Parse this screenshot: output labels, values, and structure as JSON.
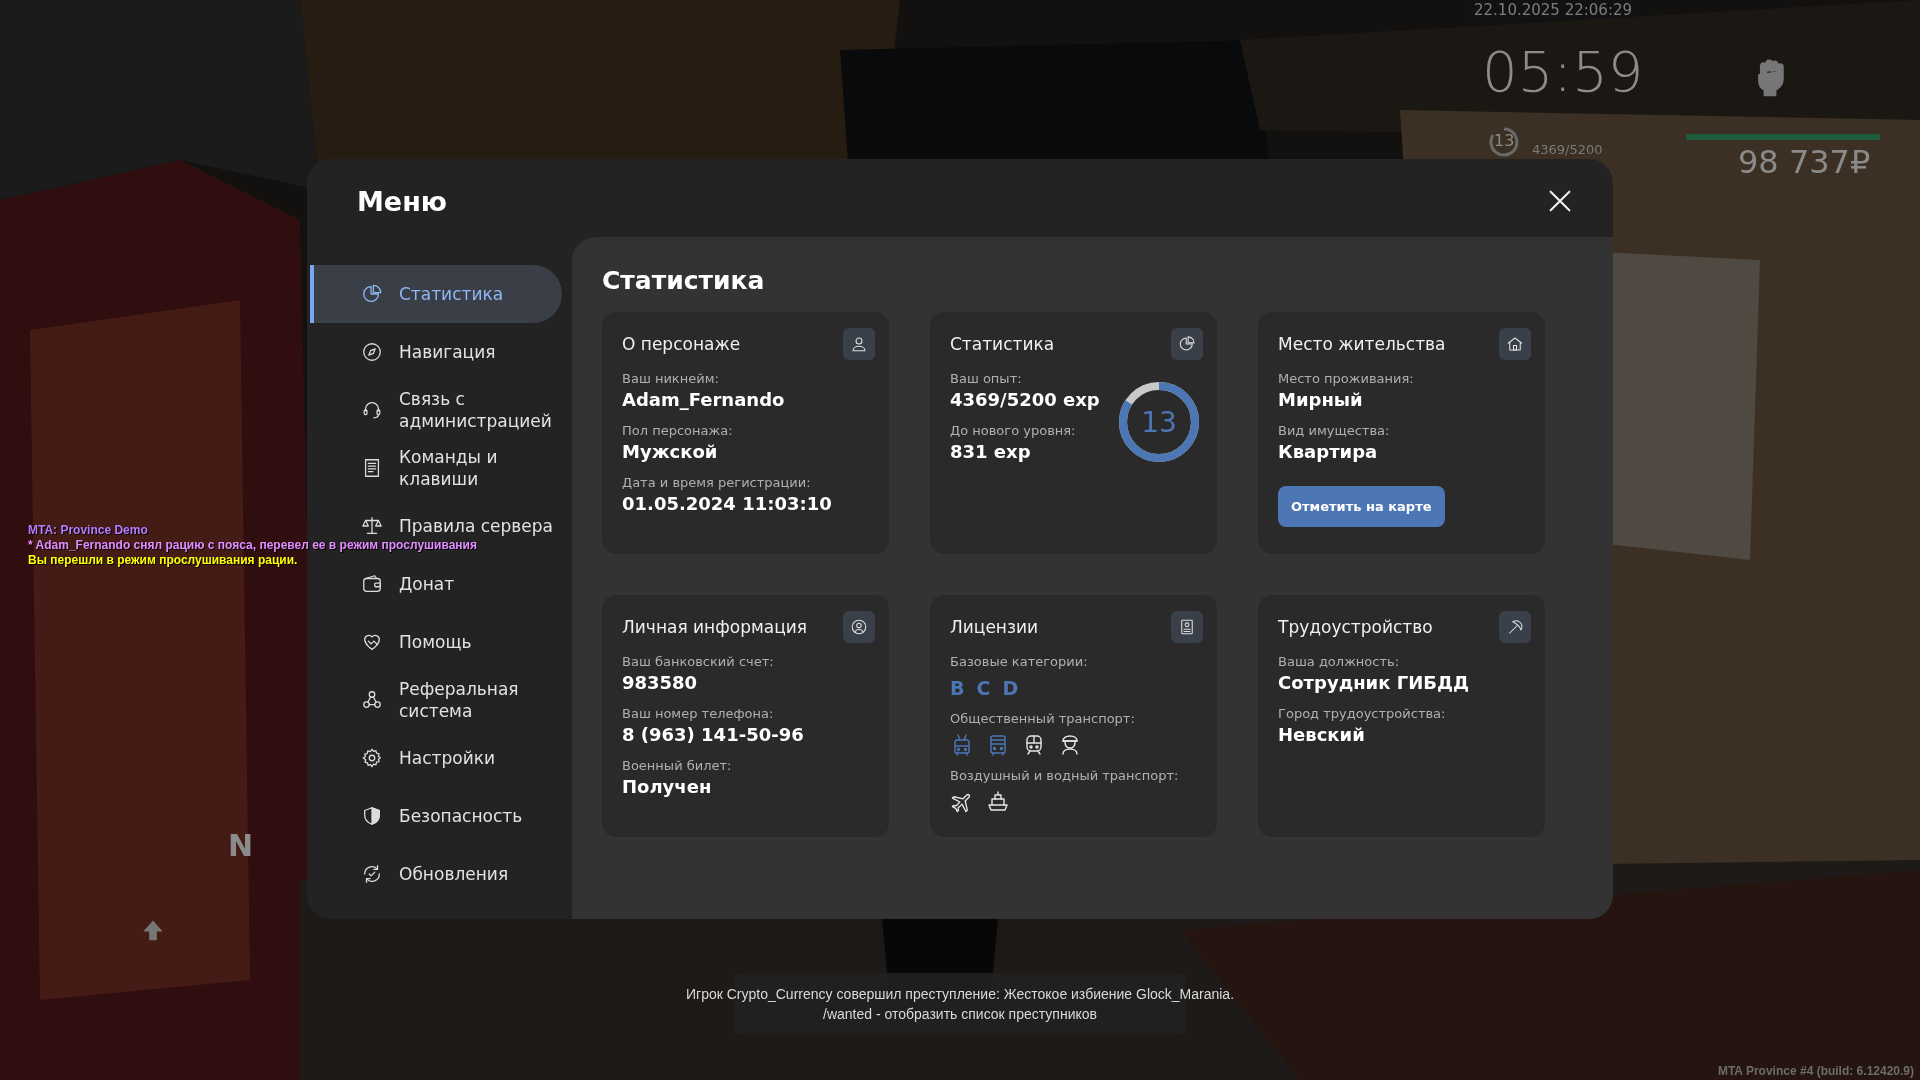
{
  "hud": {
    "datetime": "22.10.2025 22:06:29",
    "clock": "05:59",
    "level": "13",
    "experience": "4369/5200",
    "health": {
      "level": 1
    },
    "money": "98 737₽"
  },
  "chat": [
    {
      "text": "MTA: Province Demo",
      "color": "#b47cff"
    },
    {
      "text": "* Adam_Fernando снял рацию с пояса, перевел ее в режим прослушивания",
      "color": "#e38cff"
    },
    {
      "text": "Вы перешли в режим прослушивания рации.",
      "color": "#ffff00"
    }
  ],
  "compass": "N",
  "menu": {
    "title": "Меню",
    "sidebar": {
      "items": [
        {
          "label": "Статистика",
          "selected": true
        },
        {
          "label": "Навигация",
          "selected": false
        },
        {
          "label": "Связь с администрацией",
          "selected": false
        },
        {
          "label": "Команды и клавиши",
          "selected": false
        },
        {
          "label": "Правила сервера",
          "selected": false
        },
        {
          "label": "Донат",
          "selected": false
        },
        {
          "label": "Помощь",
          "selected": false
        },
        {
          "label": "Реферальная система",
          "selected": false
        },
        {
          "label": "Настройки",
          "selected": false
        },
        {
          "label": "Безопасность",
          "selected": false
        },
        {
          "label": "Обновления",
          "selected": false
        }
      ]
    },
    "content": {
      "title": "Статистика",
      "cards": [
        {
          "title": "О персонаже",
          "fields": [
            {
              "kind": "text",
              "label": "Ваш никнейм:",
              "value": "Adam_Fernando"
            },
            {
              "kind": "text",
              "label": "Пол персонажа:",
              "value": "Мужской"
            },
            {
              "kind": "text",
              "label": "Дата и время регистрации:",
              "value": "01.05.2024 11:03:10"
            }
          ]
        },
        {
          "title": "Статистика",
          "fields": [
            {
              "kind": "text",
              "label": "Ваш опыт:",
              "value": "4369/5200 exp"
            },
            {
              "kind": "text",
              "label": "До нового уровня:",
              "value": "831 exp"
            }
          ],
          "ring": {
            "label": "13",
            "level": 0.84
          }
        },
        {
          "title": "Место жительства",
          "fields": [
            {
              "kind": "text",
              "label": "Место проживания:",
              "value": "Мирный"
            },
            {
              "kind": "text",
              "label": "Вид имущества:",
              "value": "Квартира"
            }
          ],
          "button": "Отметить на карте"
        },
        {
          "title": "Личная информация",
          "fields": [
            {
              "kind": "text",
              "label": "Ваш банковский счет:",
              "value": "983580"
            },
            {
              "kind": "text",
              "label": "Ваш номер телефона:",
              "value": "8 (963) 141-50-96"
            },
            {
              "kind": "text",
              "label": "Военный билет:",
              "value": "Получен"
            }
          ]
        },
        {
          "title": "Лицензии",
          "fields": [
            {
              "kind": "letters",
              "label": "Базовые категории:",
              "items": [
                {
                  "text": "B",
                  "active": true
                },
                {
                  "text": "C",
                  "active": true
                },
                {
                  "text": "D",
                  "active": true
                }
              ]
            },
            {
              "kind": "icons",
              "label": "Общественный транспорт:",
              "items": [
                {
                  "active": true
                },
                {
                  "active": true
                },
                {
                  "active": false
                },
                {
                  "active": false
                }
              ]
            },
            {
              "kind": "icons",
              "label": "Воздушный и водный транспорт:",
              "items": [
                {
                  "active": false
                },
                {
                  "active": false
                }
              ]
            }
          ]
        },
        {
          "title": "Трудоустройство",
          "fields": [
            {
              "kind": "text",
              "label": "Ваша должность:",
              "value": "Сотрудник ГИБДД"
            },
            {
              "kind": "text",
              "label": "Город трудоустройства:",
              "value": "Невский"
            }
          ]
        }
      ]
    }
  },
  "notice": {
    "lines": [
      "Игрок Crypto_Currency совершил преступление: Жестокое избиение Glock_Marania.",
      "/wanted - отобразить список преступников"
    ]
  },
  "build": "MTA Province #4 (build: 6.12420.9)"
}
